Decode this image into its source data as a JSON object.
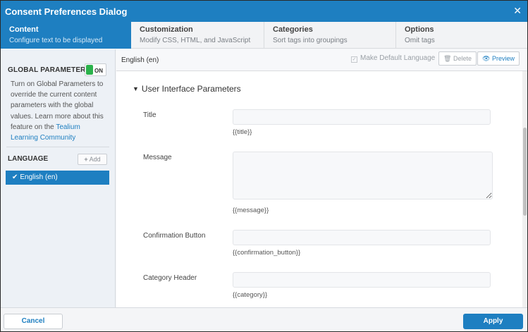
{
  "dialog": {
    "title": "Consent Preferences Dialog",
    "close_icon": "close-icon"
  },
  "tabs": [
    {
      "name": "Content",
      "desc": "Configure text to be displayed",
      "active": true
    },
    {
      "name": "Customization",
      "desc": "Modify CSS, HTML, and JavaScript",
      "active": false
    },
    {
      "name": "Categories",
      "desc": "Sort tags into groupings",
      "active": false
    },
    {
      "name": "Options",
      "desc": "Omit tags",
      "active": false
    }
  ],
  "sidebar": {
    "global_parameters_label": "GLOBAL PARAMETERS",
    "toggle_state": "ON",
    "desc_text": "Turn on Global Parameters to override the current content parameters with the global values. Learn more about this feature on the ",
    "desc_link": "Tealium Learning Community",
    "language_label": "LANGUAGE",
    "add_label": "Add",
    "languages": [
      {
        "label": "English (en)",
        "selected": true
      }
    ]
  },
  "main": {
    "language_name": "English (en)",
    "make_default_label": "Make Default Language",
    "delete_label": "Delete",
    "preview_label": "Preview",
    "section_title": "User Interface Parameters",
    "fields": [
      {
        "label": "Title",
        "value": "",
        "help": "{{title}}"
      },
      {
        "label": "Message",
        "value": "",
        "help": "{{message}}"
      },
      {
        "label": "Confirmation Button",
        "value": "",
        "help": "{{confirmation_button}}"
      },
      {
        "label": "Category Header",
        "value": "",
        "help": "{{category}}"
      }
    ]
  },
  "footer": {
    "cancel_label": "Cancel",
    "apply_label": "Apply"
  },
  "colors": {
    "accent": "#1e7fc1",
    "toggle_on": "#2bb24c"
  }
}
